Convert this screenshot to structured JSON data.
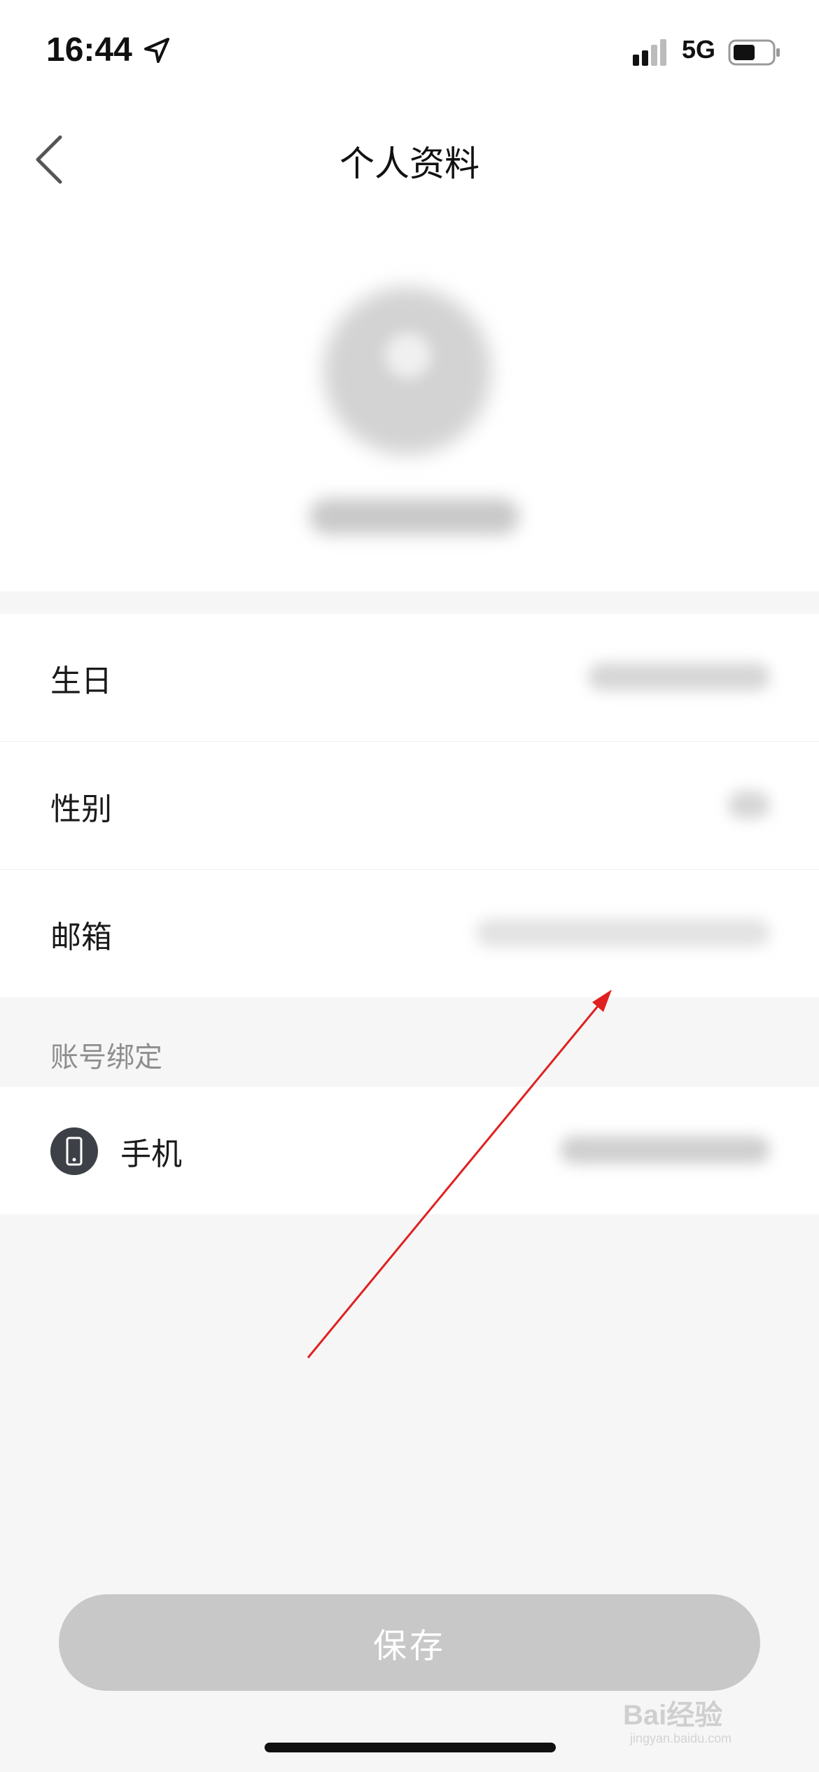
{
  "status_bar": {
    "time": "16:44",
    "network": "5G"
  },
  "nav": {
    "title": "个人资料"
  },
  "profile_rows": [
    {
      "label": "生日"
    },
    {
      "label": "性别"
    },
    {
      "label": "邮箱"
    }
  ],
  "account_binding": {
    "section_title": "账号绑定",
    "rows": [
      {
        "label": "手机",
        "icon": "phone-icon"
      }
    ]
  },
  "save_label": "保存",
  "watermark": {
    "text": "Bai经验",
    "sub": "jingyan.baidu.com"
  },
  "colors": {
    "accent_annotation": "#e02020",
    "save_disabled": "#c8c8c8",
    "icon_bg": "#3d4147"
  }
}
